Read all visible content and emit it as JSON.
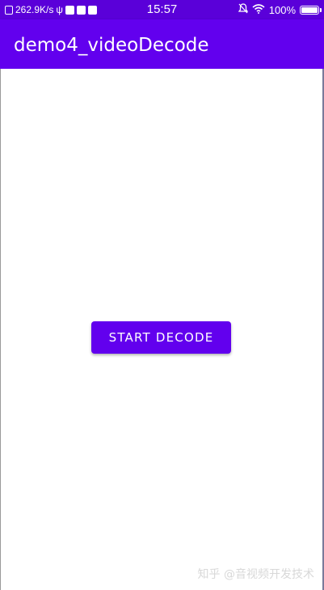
{
  "status_bar": {
    "network_speed": "262.9K/s",
    "time": "15:57",
    "battery_percent": "100%",
    "left_icons": [
      "sim-icon",
      "usb-icon",
      "notification-icon",
      "mail-icon",
      "download-icon"
    ],
    "right_icons": [
      "mute-icon",
      "wifi-icon",
      "battery-icon"
    ]
  },
  "app_bar": {
    "title": "demo4_videoDecode"
  },
  "main": {
    "decode_button_label": "START DECODE"
  },
  "watermark": {
    "text": "知乎 @音视频开发技术"
  },
  "colors": {
    "status_bar": "#5a00d9",
    "primary": "#6200ee",
    "on_primary": "#ffffff",
    "background": "#ffffff"
  }
}
